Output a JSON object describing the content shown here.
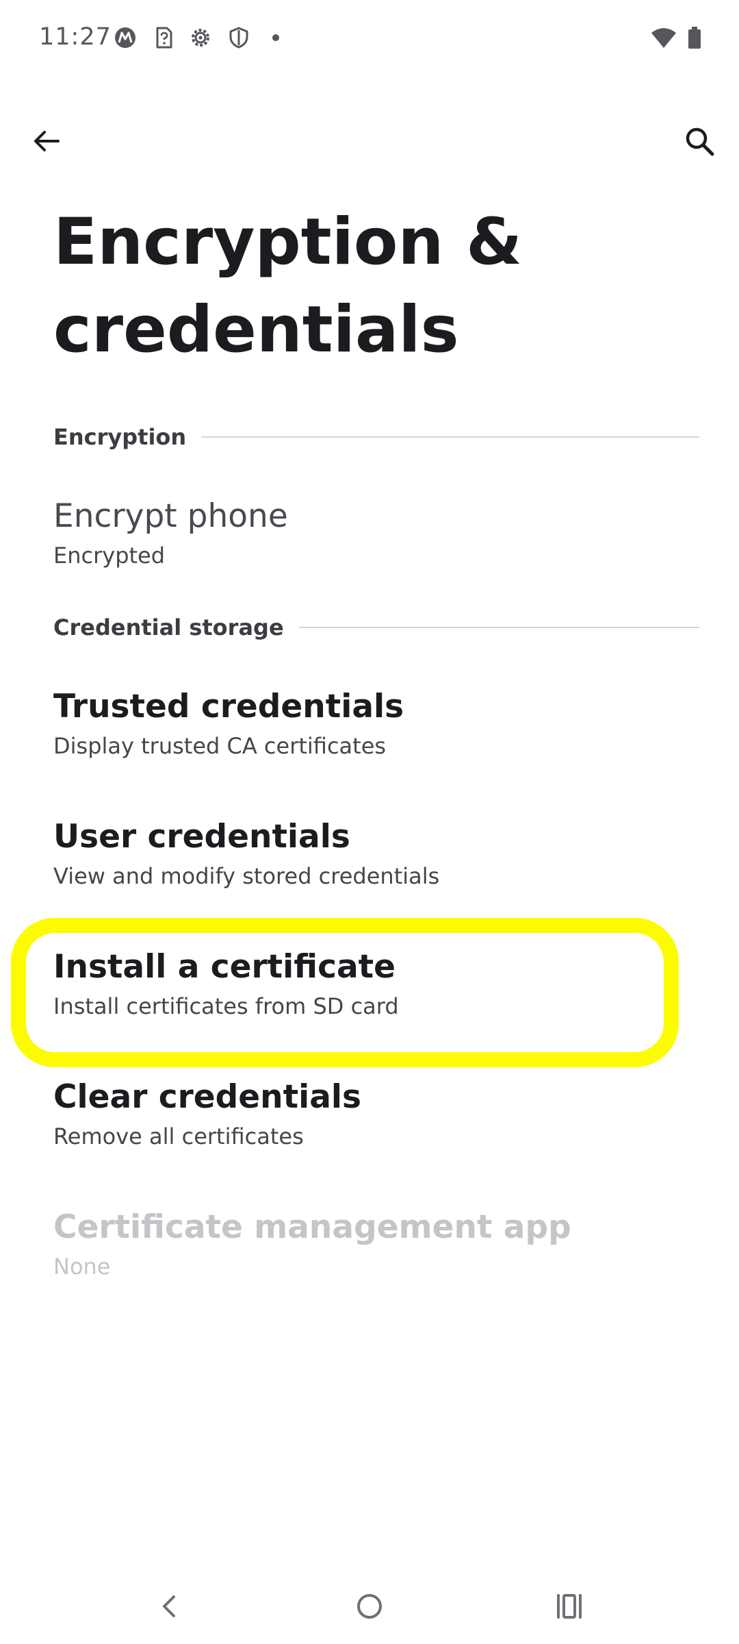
{
  "status_bar": {
    "time": "11:27",
    "icons": [
      "motorola-icon",
      "sim-question-icon",
      "settings-gear-icon",
      "shield-icon",
      "dot-icon",
      "wifi-icon",
      "battery-icon"
    ]
  },
  "app_bar": {
    "back_icon": "arrow-back-icon",
    "search_icon": "search-icon"
  },
  "title": "Encryption & credentials",
  "sections": {
    "encryption": {
      "header": "Encryption",
      "items": [
        {
          "title": "Encrypt phone",
          "summary": "Encrypted"
        }
      ]
    },
    "credential_storage": {
      "header": "Credential storage",
      "items": [
        {
          "title": "Trusted credentials",
          "summary": "Display trusted CA certificates"
        },
        {
          "title": "User credentials",
          "summary": "View and modify stored credentials"
        },
        {
          "title": "Install a certificate",
          "summary": "Install certificates from SD card",
          "highlighted": true
        },
        {
          "title": "Clear credentials",
          "summary": "Remove all certificates"
        },
        {
          "title": "Certificate management app",
          "summary": "None",
          "disabled": true
        }
      ]
    }
  },
  "highlight_color": "#fdfb00",
  "nav_bar": {
    "back_icon": "nav-back-icon",
    "home_icon": "nav-home-icon",
    "recents_icon": "nav-recents-icon"
  }
}
